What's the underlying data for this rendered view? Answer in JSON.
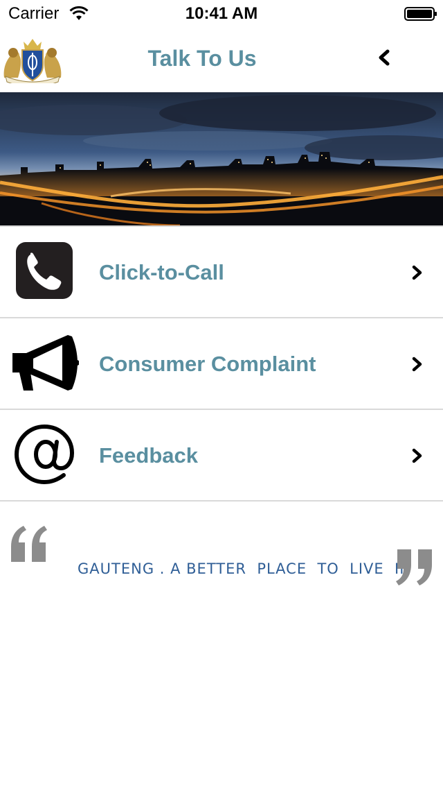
{
  "status_bar": {
    "carrier": "Carrier",
    "time": "10:41 AM"
  },
  "nav": {
    "title": "Talk To Us",
    "back_icon": "chevron-left-icon",
    "logo_icon": "coat-of-arms-icon"
  },
  "banner": {
    "description_icon": "city-night-panorama-image"
  },
  "menu": {
    "items": [
      {
        "label": "Click-to-Call",
        "icon": "phone-icon"
      },
      {
        "label": "Consumer Complaint",
        "icon": "megaphone-icon"
      },
      {
        "label": "Feedback",
        "icon": "at-sign-icon"
      }
    ]
  },
  "footer": {
    "slogan": "GAUTENG . A BETTER  PLACE  TO  LIVE  IN"
  },
  "colors": {
    "accent": "#5a8fa0",
    "slogan": "#2f5e96",
    "divider": "#d9d9d9",
    "quote": "#8c8c8c"
  }
}
